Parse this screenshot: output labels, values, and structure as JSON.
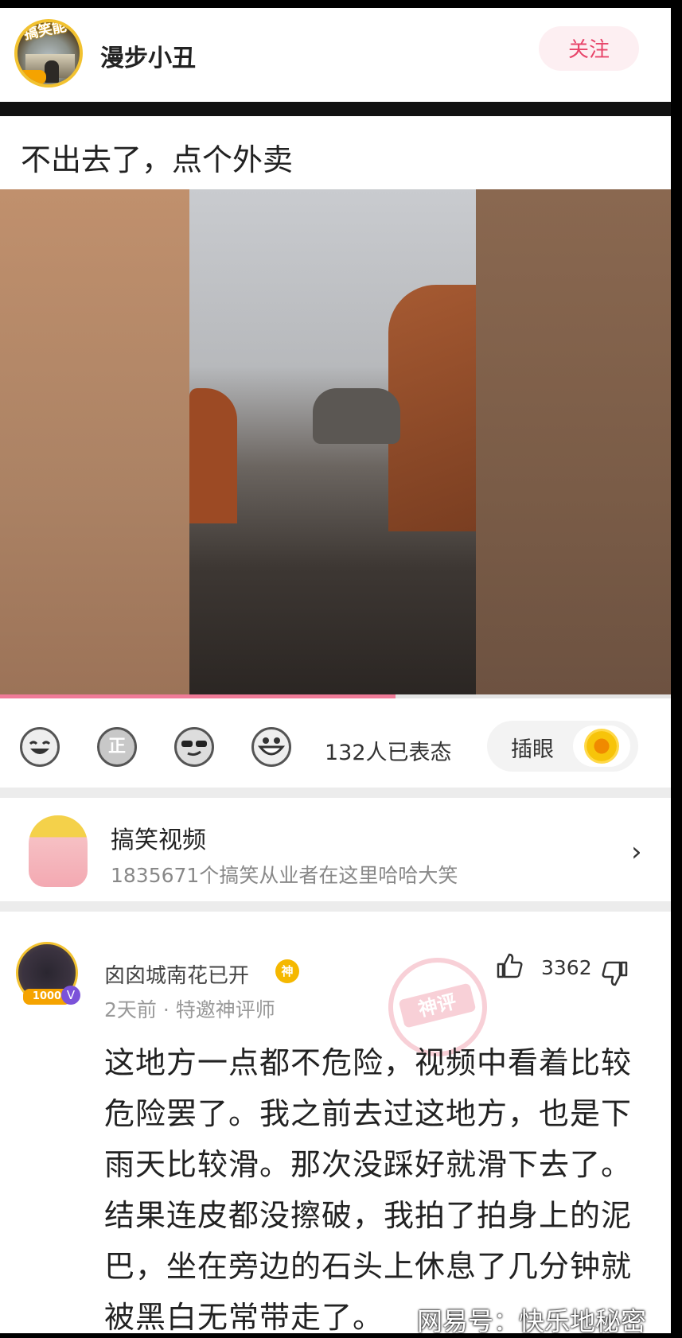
{
  "header": {
    "username": "漫步小丑",
    "avatar_badge": "搞笑能手",
    "follow_label": "关注"
  },
  "post": {
    "title": "不出去了，点个外卖"
  },
  "video": {
    "progress": 0.59
  },
  "reactions": {
    "emojis": [
      "laugh-cry-emoji",
      "zheng-emoji",
      "cool-sunglasses-emoji",
      "grin-emoji"
    ],
    "zheng_text": "正",
    "count_label": "132人已表态",
    "pill_label": "插眼",
    "pill_icon": "sunflower-icon"
  },
  "channel": {
    "name": "搞笑视频",
    "description": "1835671个搞笑从业者在这里哈哈大笑"
  },
  "comment": {
    "author": "囟囟城南花已开",
    "author_badge": "神",
    "avatar_level": "1000",
    "verified": "V",
    "meta": "2天前 · 特邀神评师",
    "stamp": "神评",
    "likes": "3362",
    "text": "这地方一点都不危险，视频中看着比较危险罢了。我之前去过这地方，也是下雨天比较滑。那次没踩好就滑下去了。结果连皮都没擦破，我拍了拍身上的泥巴，坐在旁边的石头上休息了几分钟就被黑白无常带走了。"
  },
  "watermark": "网易号：快乐地秘密",
  "colors": {
    "accent": "#e8456a",
    "follow_bg": "#fdeff2",
    "progress": "#f07b98"
  }
}
